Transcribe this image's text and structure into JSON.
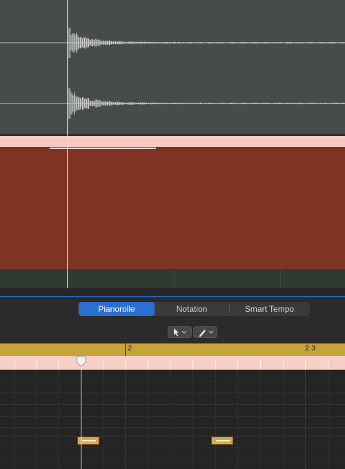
{
  "editor": {
    "tabs": [
      {
        "label": "Pianorolle",
        "active": true
      },
      {
        "label": "Notation",
        "active": false
      },
      {
        "label": "Smart Tempo",
        "active": false
      }
    ],
    "tools": [
      {
        "icon": "pointer-tool-icon",
        "has_menu": true
      },
      {
        "icon": "pencil-tool-icon",
        "has_menu": true
      }
    ]
  },
  "ruler": {
    "bar_2": "2",
    "bar_2_3": "2 3"
  },
  "colors": {
    "audio_track_bg": "#474c49",
    "midi_region": "#7e3323",
    "midi_region_header": "#f9c8bf",
    "ruler": "#c5a43a",
    "active_tab": "#2c6fd3",
    "note": "#d9a84d"
  }
}
